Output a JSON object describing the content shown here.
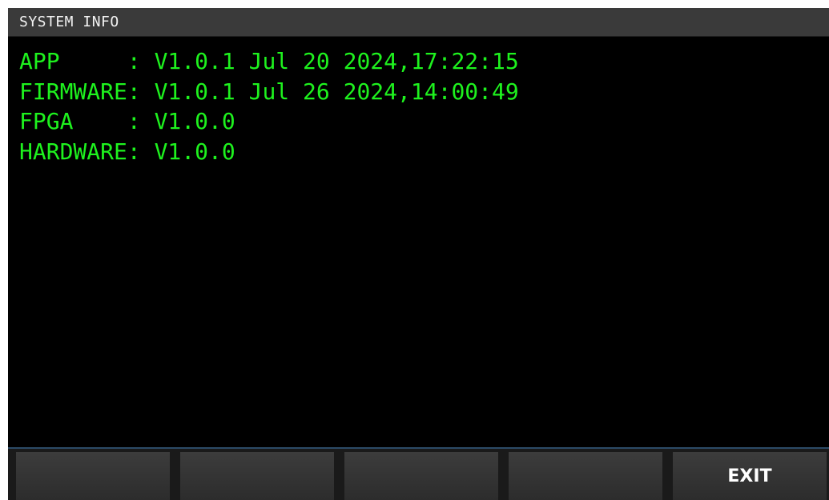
{
  "window": {
    "title": "SYSTEM INFO"
  },
  "info": {
    "rows": [
      {
        "key": "APP     ",
        "separator": ": ",
        "value": "V1.0.1 Jul 20 2024,17:22:15"
      },
      {
        "key": "FIRMWARE",
        "separator": ": ",
        "value": "V1.0.1 Jul 26 2024,14:00:49"
      },
      {
        "key": "FPGA    ",
        "separator": ": ",
        "value": "V1.0.0"
      },
      {
        "key": "HARDWARE",
        "separator": ": ",
        "value": "V1.0.0"
      }
    ]
  },
  "softkeys": [
    {
      "label": ""
    },
    {
      "label": ""
    },
    {
      "label": ""
    },
    {
      "label": ""
    },
    {
      "label": "EXIT"
    }
  ],
  "colors": {
    "screen_background": "#000000",
    "info_text": "#1ef21e",
    "title_bar": "#3a3a3a",
    "softkey_label": "#ffffff"
  }
}
